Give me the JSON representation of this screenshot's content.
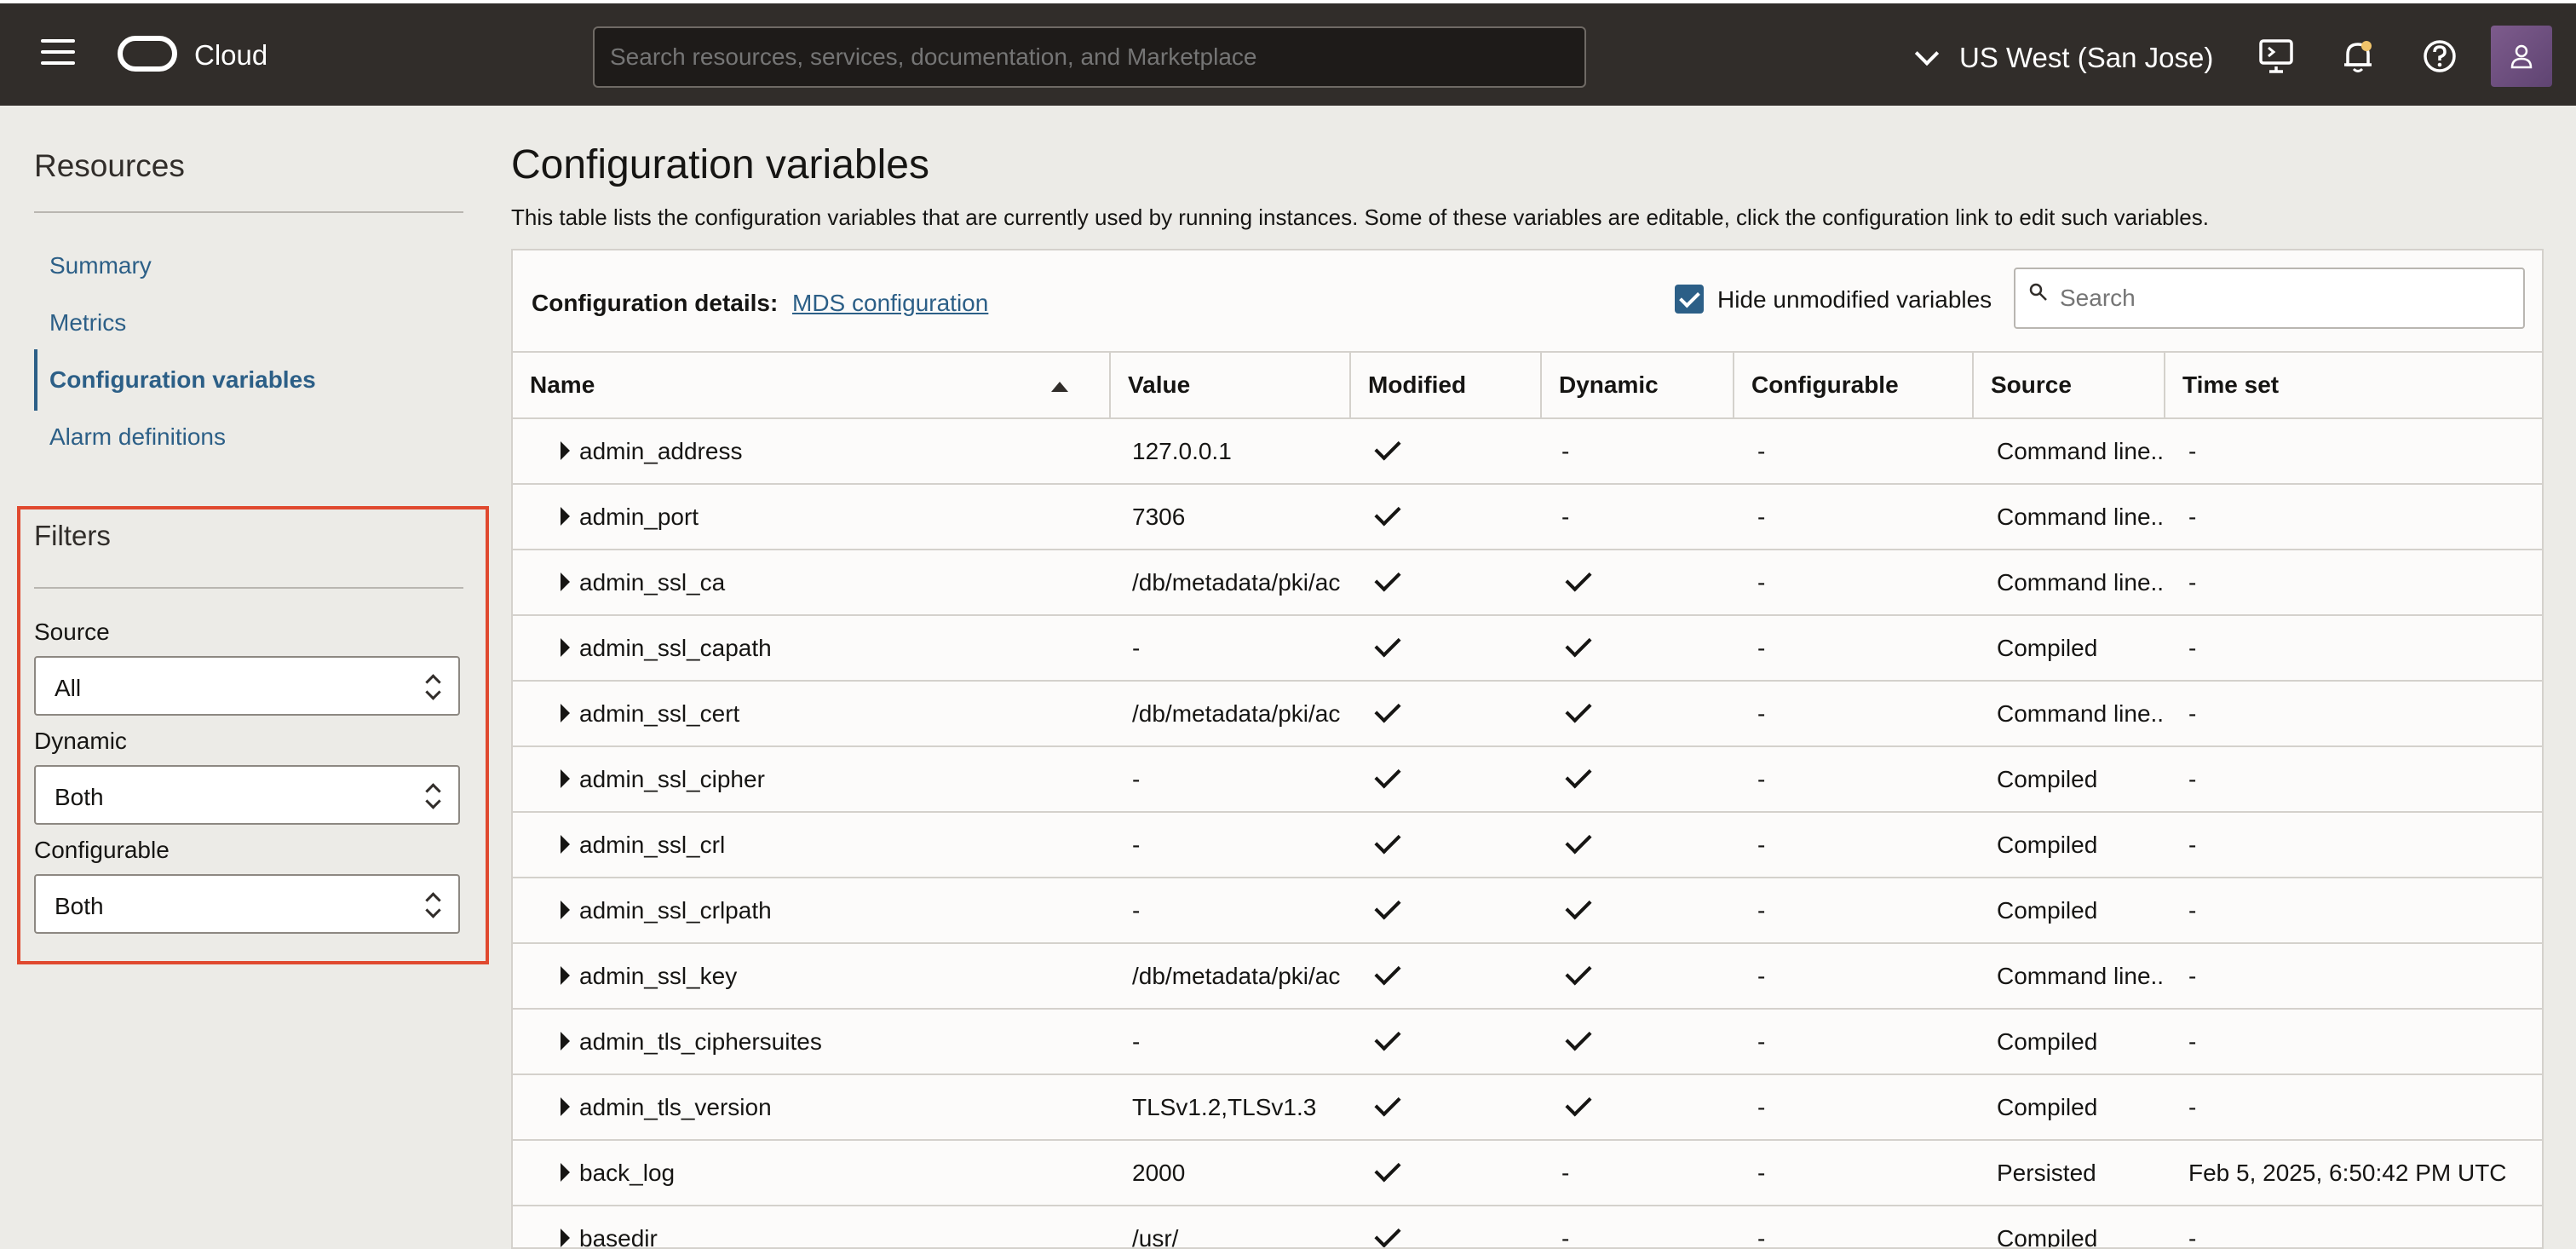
{
  "header": {
    "brand": "Cloud",
    "search_placeholder": "Search resources, services, documentation, and Marketplace",
    "region": "US West (San Jose)"
  },
  "sidebar": {
    "title": "Resources",
    "items": [
      {
        "label": "Summary"
      },
      {
        "label": "Metrics"
      },
      {
        "label": "Configuration variables",
        "active": true
      },
      {
        "label": "Alarm definitions"
      }
    ]
  },
  "filters": {
    "title": "Filters",
    "source_label": "Source",
    "source_value": "All",
    "dynamic_label": "Dynamic",
    "dynamic_value": "Both",
    "configurable_label": "Configurable",
    "configurable_value": "Both"
  },
  "main": {
    "title": "Configuration variables",
    "description": "This table lists the configuration variables that are currently used by running instances. Some of these variables are editable, click the configuration link to edit such variables.",
    "config_label": "Configuration details:",
    "config_link": "MDS configuration",
    "hide_unmodified_label": "Hide unmodified variables",
    "hide_unmodified_checked": true,
    "search_placeholder": "Search"
  },
  "table": {
    "columns": [
      "Name",
      "Value",
      "Modified",
      "Dynamic",
      "Configurable",
      "Source",
      "Time set"
    ],
    "rows": [
      {
        "name": "admin_address",
        "value": "127.0.0.1",
        "modified": true,
        "dynamic": "-",
        "configurable": "-",
        "source": "Command line..",
        "time_set": "-"
      },
      {
        "name": "admin_port",
        "value": "7306",
        "modified": true,
        "dynamic": "-",
        "configurable": "-",
        "source": "Command line..",
        "time_set": "-"
      },
      {
        "name": "admin_ssl_ca",
        "value": "/db/metadata/pki/ac",
        "modified": true,
        "dynamic": true,
        "configurable": "-",
        "source": "Command line..",
        "time_set": "-"
      },
      {
        "name": "admin_ssl_capath",
        "value": "-",
        "modified": true,
        "dynamic": true,
        "configurable": "-",
        "source": "Compiled",
        "time_set": "-"
      },
      {
        "name": "admin_ssl_cert",
        "value": "/db/metadata/pki/ac",
        "modified": true,
        "dynamic": true,
        "configurable": "-",
        "source": "Command line..",
        "time_set": "-"
      },
      {
        "name": "admin_ssl_cipher",
        "value": "-",
        "modified": true,
        "dynamic": true,
        "configurable": "-",
        "source": "Compiled",
        "time_set": "-"
      },
      {
        "name": "admin_ssl_crl",
        "value": "-",
        "modified": true,
        "dynamic": true,
        "configurable": "-",
        "source": "Compiled",
        "time_set": "-"
      },
      {
        "name": "admin_ssl_crlpath",
        "value": "-",
        "modified": true,
        "dynamic": true,
        "configurable": "-",
        "source": "Compiled",
        "time_set": "-"
      },
      {
        "name": "admin_ssl_key",
        "value": "/db/metadata/pki/ac",
        "modified": true,
        "dynamic": true,
        "configurable": "-",
        "source": "Command line..",
        "time_set": "-"
      },
      {
        "name": "admin_tls_ciphersuites",
        "value": "-",
        "modified": true,
        "dynamic": true,
        "configurable": "-",
        "source": "Compiled",
        "time_set": "-"
      },
      {
        "name": "admin_tls_version",
        "value": "TLSv1.2,TLSv1.3",
        "modified": true,
        "dynamic": true,
        "configurable": "-",
        "source": "Compiled",
        "time_set": "-"
      },
      {
        "name": "back_log",
        "value": "2000",
        "modified": true,
        "dynamic": "-",
        "configurable": "-",
        "source": "Persisted",
        "time_set": "Feb 5, 2025, 6:50:42 PM UTC"
      },
      {
        "name": "basedir",
        "value": "/usr/",
        "modified": true,
        "dynamic": "-",
        "configurable": "-",
        "source": "Compiled",
        "time_set": "-"
      }
    ]
  },
  "colors": {
    "topbar": "#312d2a",
    "link": "#2c5f87",
    "highlight": "#e0492f"
  }
}
